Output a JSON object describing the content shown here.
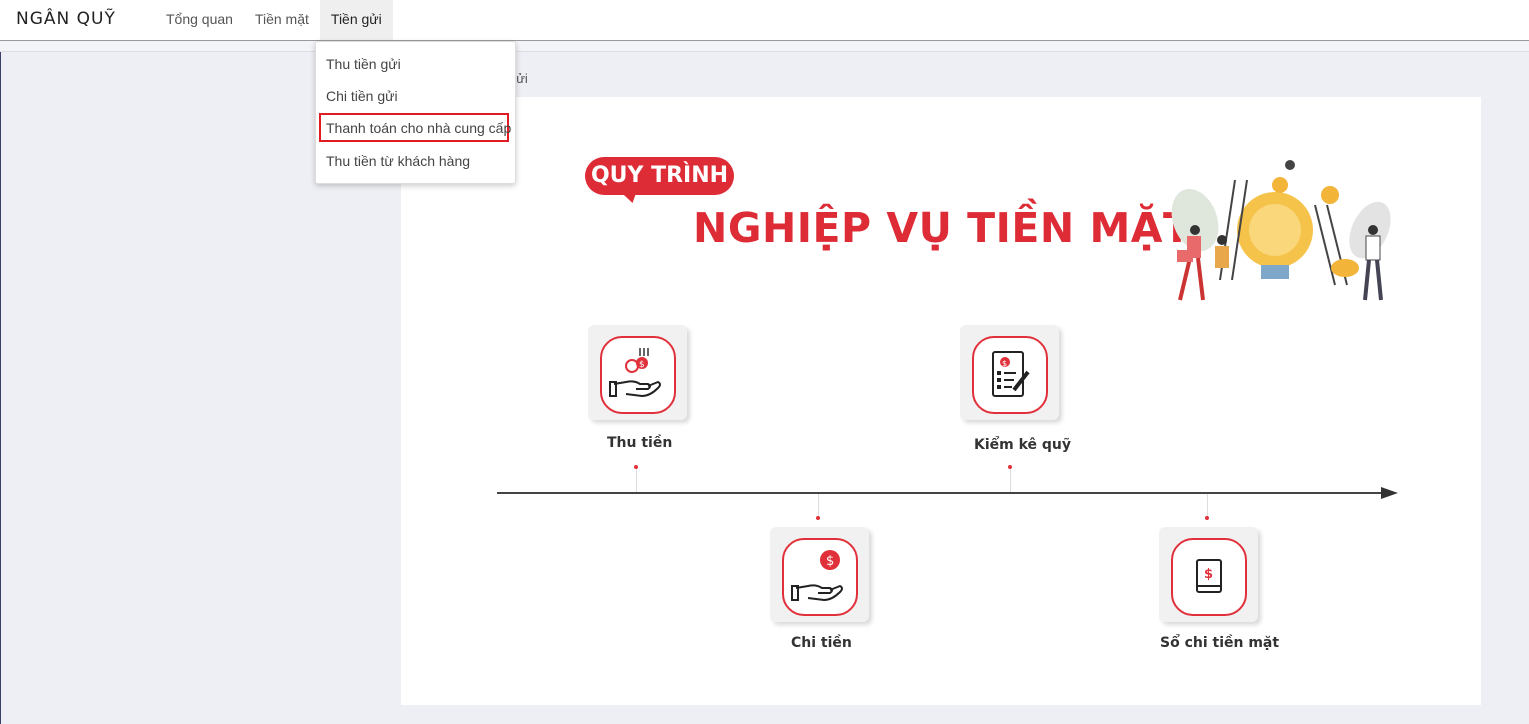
{
  "header": {
    "brand": "NGÂN QUỸ",
    "nav": [
      {
        "label": "Tổng quan"
      },
      {
        "label": "Tiền mặt"
      },
      {
        "label": "Tiền gửi"
      }
    ]
  },
  "dropdown": {
    "items": [
      {
        "label": "Thu tiền gửi"
      },
      {
        "label": "Chi tiền gửi"
      },
      {
        "label": "Thanh toán cho nhà cung cấp"
      },
      {
        "label": "Thu tiền từ khách hàng"
      }
    ],
    "highlighted_index": 2
  },
  "breadcrumb": "gửi",
  "banner": {
    "badge": "QUY TRÌNH",
    "title": "NGHIỆP VỤ TIỀN MẶT"
  },
  "steps": [
    {
      "label": "Thu tiền",
      "icon": "money-receive-icon"
    },
    {
      "label": "Chi tiền",
      "icon": "money-give-icon"
    },
    {
      "label": "Kiểm kê quỹ",
      "icon": "checklist-icon"
    },
    {
      "label": "Sổ chi tiền mặt",
      "icon": "cash-book-icon"
    }
  ],
  "colors": {
    "accent": "#de2c36",
    "highlight_border": "#e01b22"
  }
}
